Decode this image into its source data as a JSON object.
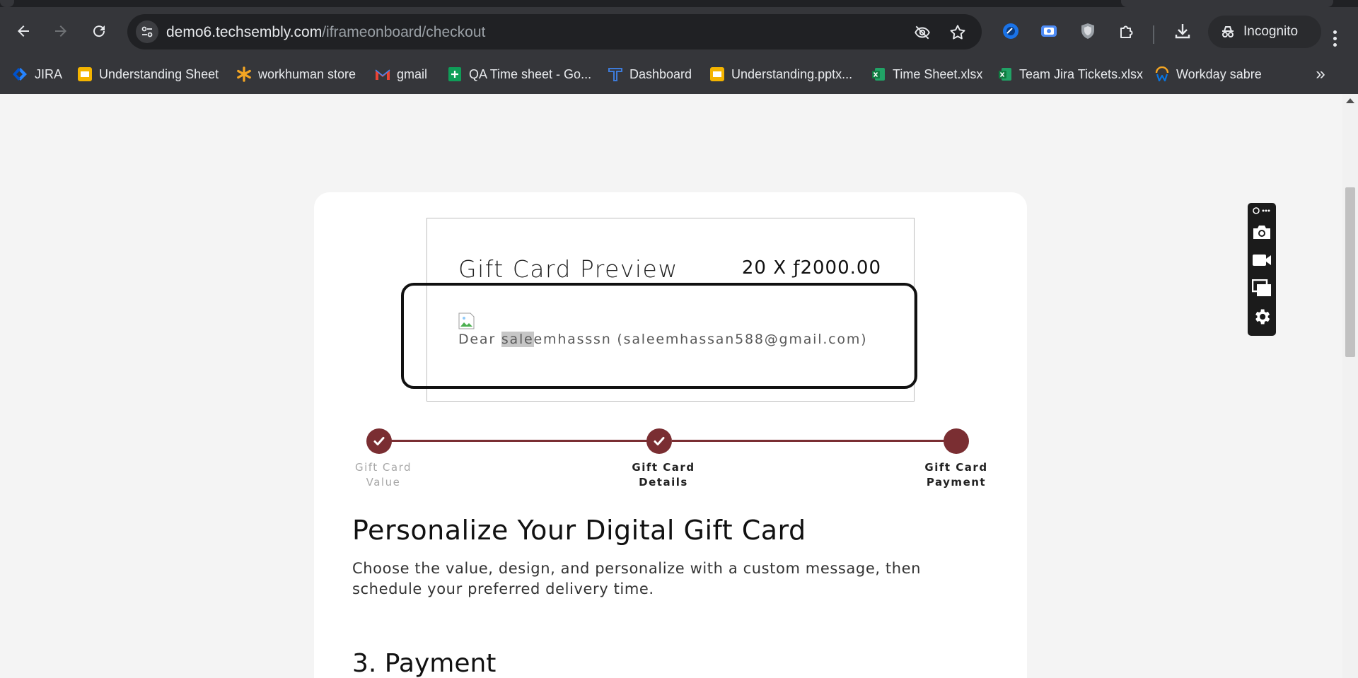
{
  "browser": {
    "url_host": "demo6.techsembly.com",
    "url_path": "/iframeonboard/checkout",
    "incognito_label": "Incognito",
    "bookmarks": [
      {
        "label": "JIRA",
        "icon": "jira-icon"
      },
      {
        "label": "Understanding Sheet",
        "icon": "slides-icon"
      },
      {
        "label": "workhuman store",
        "icon": "asterisk-icon"
      },
      {
        "label": "gmail",
        "icon": "gmail-icon"
      },
      {
        "label": "QA Time sheet - Go...",
        "icon": "sheets-icon"
      },
      {
        "label": "Dashboard",
        "icon": "tp-icon"
      },
      {
        "label": "Understanding.pptx...",
        "icon": "slides-icon"
      },
      {
        "label": "Time Sheet.xlsx",
        "icon": "excel-icon"
      },
      {
        "label": "Team Jira Tickets.xlsx",
        "icon": "excel-icon"
      },
      {
        "label": "Workday sabre",
        "icon": "workday-icon"
      }
    ],
    "more_bookmarks": "»"
  },
  "preview": {
    "title": "Gift Card Preview",
    "amount": "20 X ƒ2000.00",
    "dear_prefix": "Dear ",
    "name_selected": "sale",
    "name_rest": "emhasssn (saleemhassan588@gmail.com)"
  },
  "steps": [
    {
      "label_line1": "Gift Card",
      "label_line2": "Value",
      "state": "complete"
    },
    {
      "label_line1": "Gift Card",
      "label_line2": "Details",
      "state": "complete"
    },
    {
      "label_line1": "Gift Card",
      "label_line2": "Payment",
      "state": "current"
    }
  ],
  "page": {
    "heading": "Personalize Your Digital Gift Card",
    "description": "Choose the value, design, and personalize with a custom message, then schedule your preferred delivery time.",
    "payment_heading": "3. Payment"
  },
  "colors": {
    "accent": "#7a2e32",
    "chrome_bg": "#35363a"
  }
}
